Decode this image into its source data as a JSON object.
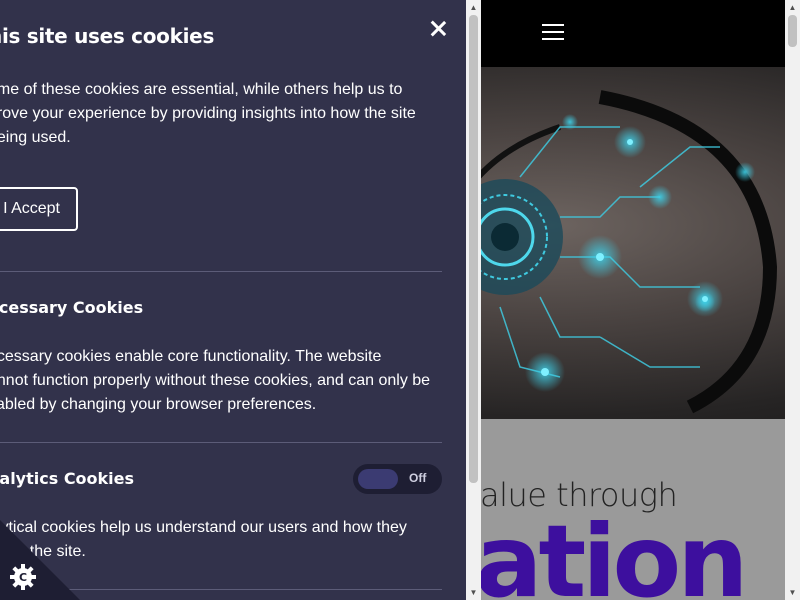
{
  "header": {
    "menu_icon": "hamburger-menu-icon"
  },
  "hero": {
    "tagline": "alue through",
    "headline": "ation"
  },
  "cookie_panel": {
    "title": "his site uses cookies",
    "intro": "ome of these cookies are essential, while others help us to\nprove your experience by providing insights into how the site\nbeing used.",
    "accept_label": "I Accept",
    "close_icon": "close-icon",
    "sections": [
      {
        "title": "ecessary Cookies",
        "description": "ecessary cookies enable core functionality. The website\nannot function properly without these cookies, and can only be\nsabled by changing your browser preferences."
      },
      {
        "title": "nalytics Cookies",
        "toggle_state": "Off",
        "description": "alytical cookies help us understand our users and how they\nt with the site."
      }
    ]
  },
  "cookie_badge": {
    "icon": "cookie-settings-icon"
  },
  "colors": {
    "panel_bg": "#32324b",
    "toggle_bg": "#1e1e33",
    "toggle_knob": "#3b3b72",
    "headline_purple": "#3d0f9e",
    "topbar_bg": "#000000"
  },
  "scrollbars": {
    "panel_scroll_position": 0.0,
    "page_scroll_position": 0.0
  }
}
